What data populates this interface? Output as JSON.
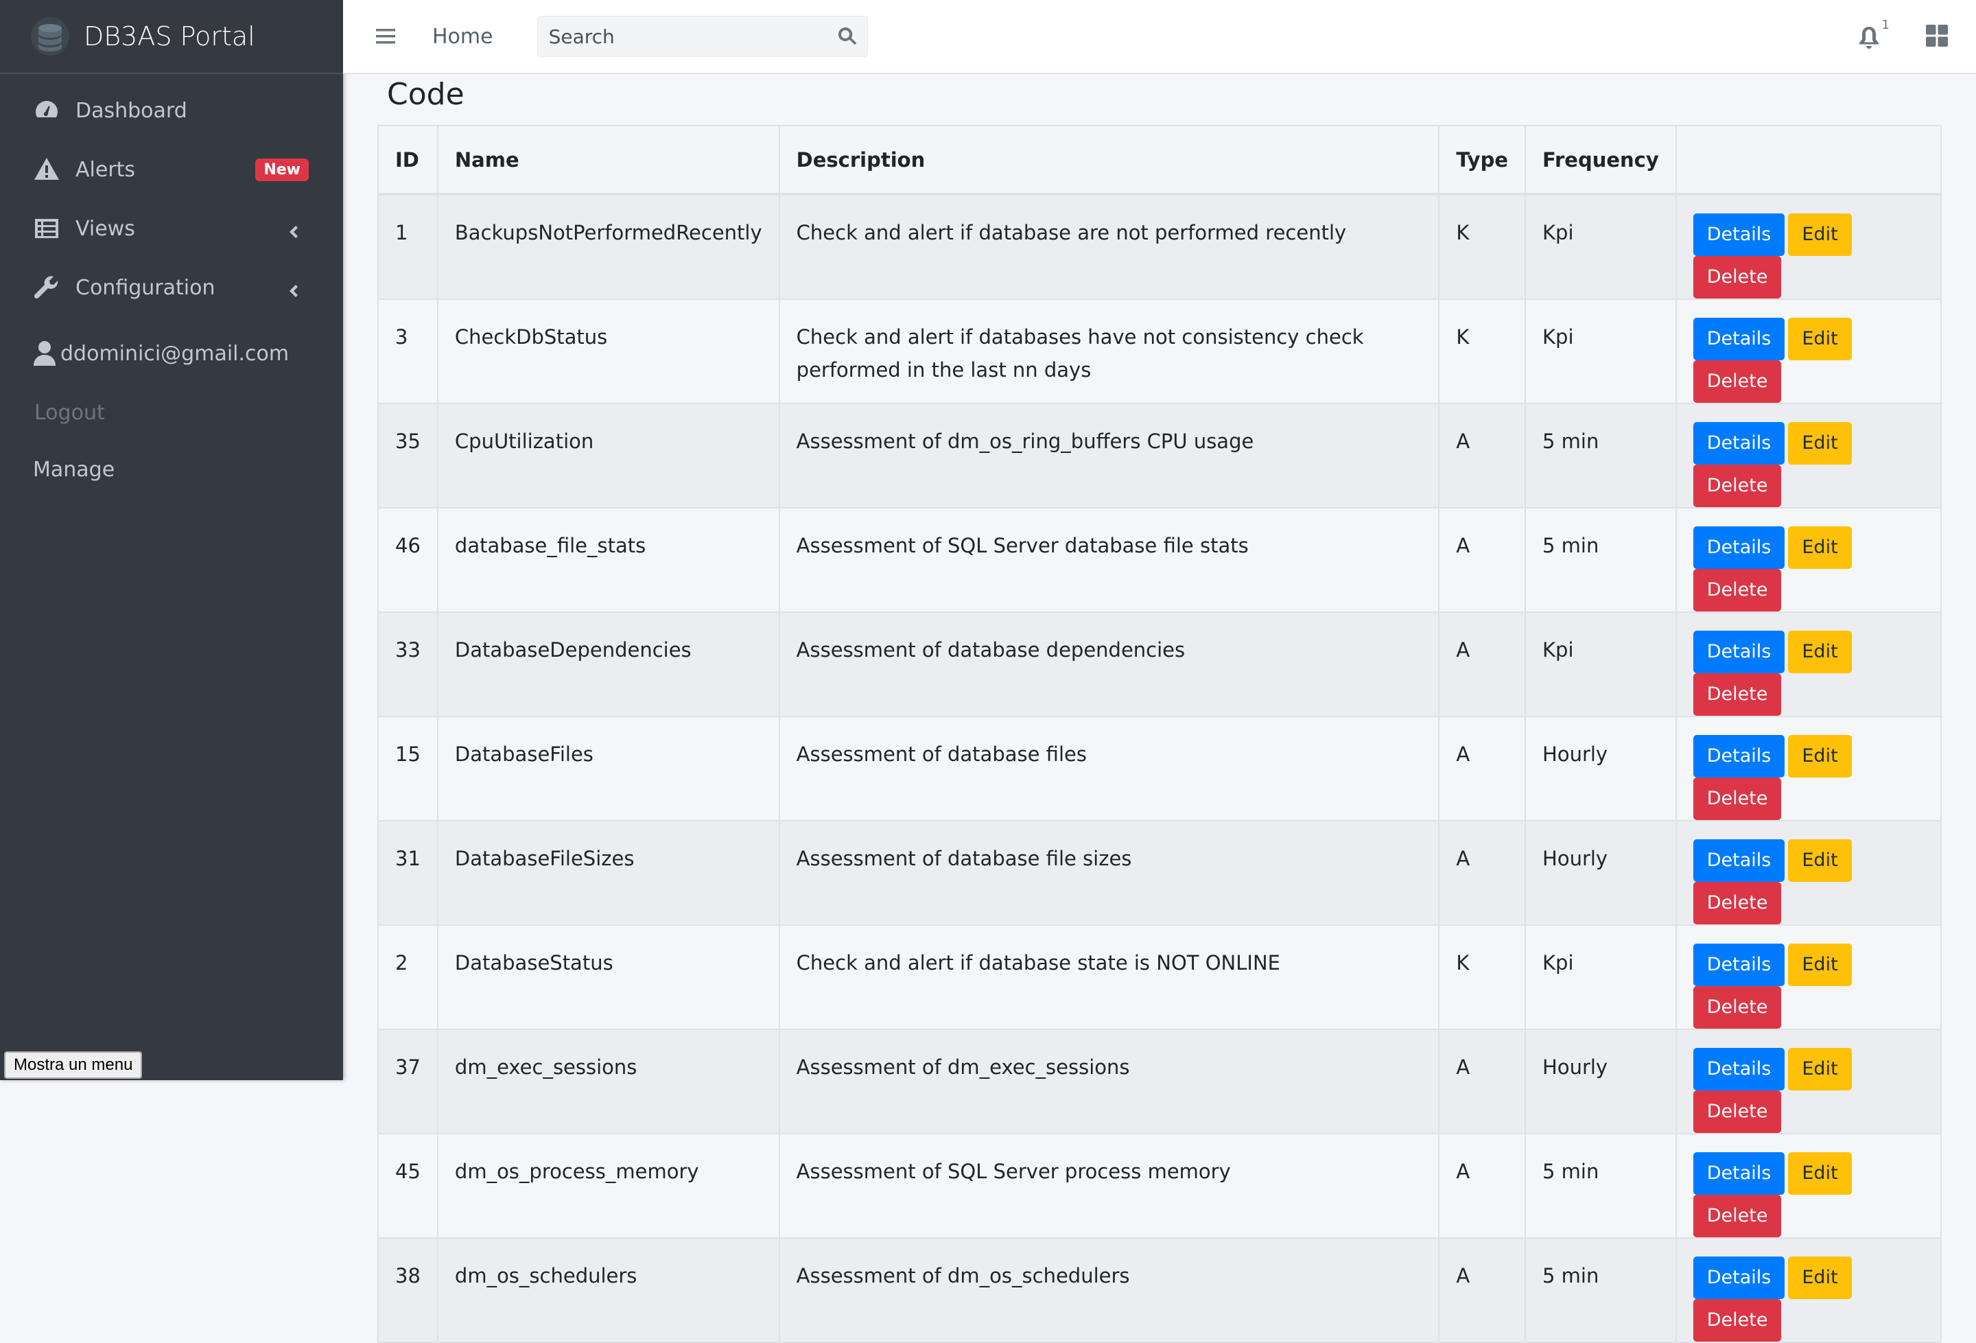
{
  "sidebar": {
    "brand": "DB3AS Portal",
    "items": [
      {
        "label": "Dashboard",
        "icon": "tachometer-icon"
      },
      {
        "label": "Alerts",
        "icon": "warning-icon",
        "badge": "New"
      },
      {
        "label": "Views",
        "icon": "list-icon"
      },
      {
        "label": "Configuration",
        "icon": "wrench-icon"
      }
    ],
    "user_email": "ddominici@gmail.com",
    "logout": "Logout",
    "manage": "Manage",
    "tooltip_button": "Mostra un menu"
  },
  "topbar": {
    "home": "Home",
    "search_placeholder": "Search",
    "notification_count": "1"
  },
  "page": {
    "title": "Code"
  },
  "table": {
    "headers": [
      "ID",
      "Name",
      "Description",
      "Type",
      "Frequency",
      ""
    ],
    "action_labels": {
      "details": "Details",
      "edit": "Edit",
      "delete": "Delete"
    },
    "rows": [
      {
        "id": "1",
        "name": "BackupsNotPerformedRecently",
        "description": "Check and alert if database are not performed recently",
        "type": "K",
        "frequency": "Kpi"
      },
      {
        "id": "3",
        "name": "CheckDbStatus",
        "description": "Check and alert if databases have not consistency check performed in the last nn days",
        "type": "K",
        "frequency": "Kpi"
      },
      {
        "id": "35",
        "name": "CpuUtilization",
        "description": "Assessment of dm_os_ring_buffers CPU usage",
        "type": "A",
        "frequency": "5 min"
      },
      {
        "id": "46",
        "name": "database_file_stats",
        "description": "Assessment of SQL Server database file stats",
        "type": "A",
        "frequency": "5 min"
      },
      {
        "id": "33",
        "name": "DatabaseDependencies",
        "description": "Assessment of database dependencies",
        "type": "A",
        "frequency": "Kpi"
      },
      {
        "id": "15",
        "name": "DatabaseFiles",
        "description": "Assessment of database files",
        "type": "A",
        "frequency": "Hourly"
      },
      {
        "id": "31",
        "name": "DatabaseFileSizes",
        "description": "Assessment of database file sizes",
        "type": "A",
        "frequency": "Hourly"
      },
      {
        "id": "2",
        "name": "DatabaseStatus",
        "description": "Check and alert if database state is NOT ONLINE",
        "type": "K",
        "frequency": "Kpi"
      },
      {
        "id": "37",
        "name": "dm_exec_sessions",
        "description": "Assessment of dm_exec_sessions",
        "type": "A",
        "frequency": "Hourly"
      },
      {
        "id": "45",
        "name": "dm_os_process_memory",
        "description": "Assessment of SQL Server process memory",
        "type": "A",
        "frequency": "5 min"
      },
      {
        "id": "38",
        "name": "dm_os_schedulers",
        "description": "Assessment of dm_os_schedulers",
        "type": "A",
        "frequency": "5 min"
      }
    ]
  },
  "colors": {
    "sidebar_bg": "#343a40",
    "primary": "#007bff",
    "warning": "#ffc107",
    "danger": "#dc3545"
  }
}
